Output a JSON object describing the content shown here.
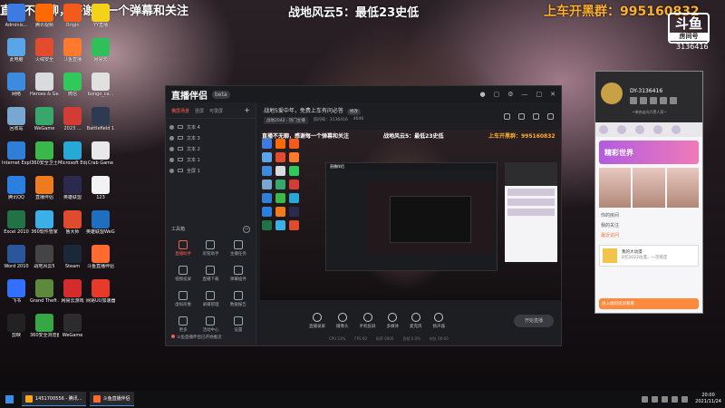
{
  "overlay": {
    "left_text": "直播不无聊，感谢每一个弹幕和关注",
    "center_text": "战地风云5：最低23史低",
    "right_text": "上车开黑群：995160832",
    "logo_text": "斗鱼",
    "logo_sub": "房间号",
    "room_id": "3136416"
  },
  "desktop_icons": [
    {
      "label": "Adminis...",
      "color": "#3d7be0"
    },
    {
      "label": "腾讯视频",
      "color": "#ff6a00"
    },
    {
      "label": "Origin",
      "color": "#f25b1b"
    },
    {
      "label": "YY直播",
      "color": "#f5d21a"
    },
    {
      "label": "此电脑",
      "color": "#5aa5e8"
    },
    {
      "label": "火绒安全",
      "color": "#e34b2e"
    },
    {
      "label": "斗鱼直播",
      "color": "#ff7a2f"
    },
    {
      "label": "网易云",
      "color": "#2fc05a"
    },
    {
      "label": "网络",
      "color": "#3d8bdf"
    },
    {
      "label": "Heroes & Generals",
      "color": "#d8dcdf"
    },
    {
      "label": "微信",
      "color": "#31c95c"
    },
    {
      "label": "bongo_ca...",
      "color": "#e0e0e0"
    },
    {
      "label": "回收站",
      "color": "#7aa7d0"
    },
    {
      "label": "WeGame",
      "color": "#36a86b"
    },
    {
      "label": "2023 ...",
      "color": "#d33b35"
    },
    {
      "label": "Battlefield 1",
      "color": "#2d3b52"
    },
    {
      "label": "Internet Explorer",
      "color": "#2f7ed8"
    },
    {
      "label": "360安全卫士",
      "color": "#3bb84a"
    },
    {
      "label": "Microsoft Edge",
      "color": "#28a8d6"
    },
    {
      "label": "Crab Game",
      "color": "#e8e8e8"
    },
    {
      "label": "腾讯QQ",
      "color": "#2a7fe0"
    },
    {
      "label": "直播伴侣",
      "color": "#f07a1e"
    },
    {
      "label": "英雄联盟",
      "color": "#2a2a4e"
    },
    {
      "label": "123",
      "color": "#f2f2f2"
    },
    {
      "label": "Excel 2010",
      "color": "#217346"
    },
    {
      "label": "360软件管家",
      "color": "#3bb0e8"
    },
    {
      "label": "鲁大师",
      "color": "#e04a2e"
    },
    {
      "label": "英雄联盟WeGame版",
      "color": "#1e6fc0"
    },
    {
      "label": "Word 2010",
      "color": "#2b579a"
    },
    {
      "label": "战地风云5",
      "color": "#444"
    },
    {
      "label": "Steam",
      "color": "#1b2838"
    },
    {
      "label": "斗鱼直播伴侣",
      "color": "#ff6a30"
    },
    {
      "label": "飞书",
      "color": "#3370ff"
    },
    {
      "label": "Grand Theft Auto V",
      "color": "#5c8a3a"
    },
    {
      "label": "网易云游戏",
      "color": "#d42c2c"
    },
    {
      "label": "网易UU加速器",
      "color": "#e83a2a"
    },
    {
      "label": "剪映",
      "color": "#222"
    },
    {
      "label": "360安全浏览器",
      "color": "#35a845"
    },
    {
      "label": "WeGame",
      "color": "#2c2c2c"
    }
  ],
  "app": {
    "logo": "直播伴侣",
    "version": "beta",
    "window_controls": [
      "最小化",
      "最大化",
      "关闭"
    ],
    "left_tabs": [
      "横屏场景",
      "竖屏",
      "可录屏"
    ],
    "sources": [
      {
        "label": "文本 4"
      },
      {
        "label": "文本 3"
      },
      {
        "label": "文本 2"
      },
      {
        "label": "文本 1"
      },
      {
        "label": "全屏 1"
      }
    ],
    "tools_heading": "工具箱",
    "tools": [
      {
        "label": "直播助手",
        "red": true
      },
      {
        "label": "房管助手",
        "red": false
      },
      {
        "label": "主播任务",
        "red": false
      },
      {
        "label": "视频投屏",
        "red": false
      },
      {
        "label": "直播下载",
        "red": false
      },
      {
        "label": "弹幕插件",
        "red": false
      },
      {
        "label": "虚拟形象",
        "red": false
      },
      {
        "label": "录播管理",
        "red": false
      },
      {
        "label": "数据报告",
        "red": false
      },
      {
        "label": "更多",
        "red": false
      },
      {
        "label": "活动中心",
        "red": false
      },
      {
        "label": "设置",
        "red": false
      }
    ],
    "left_footer": "斗鱼直播伴侣已开始推流",
    "stream_title": "战地5爱中年，免费上车有问必答",
    "edit_label": "修改",
    "meta": [
      "战地2042 · 热门主播",
      "房间号：3136416",
      "4646"
    ],
    "preview_text_left": "直播不无聊，感谢每一个弹幕和关注",
    "preview_text_center": "战地风云5：最低23史低",
    "preview_text_right": "上车开黑群：995160832",
    "preview_icon_colors": [
      "#3d7be0",
      "#ff6a00",
      "#f25b1b",
      "#5aa5e8",
      "#e34b2e",
      "#ff7a2f",
      "#3d8bdf",
      "#d8dcdf",
      "#31c95c",
      "#7aa7d0",
      "#36a86b",
      "#d33b35",
      "#2f7ed8",
      "#3bb84a",
      "#28a8d6",
      "#2a7fe0",
      "#f07a1e",
      "#2a2a4e",
      "#217346",
      "#3bb0e8",
      "#e04a2e"
    ],
    "controls": [
      "直播录屏",
      "摄像头",
      "手机投屏",
      "多媒体",
      "麦克风",
      "扬声器"
    ],
    "live_button": "开始直播",
    "status": [
      "CPU 23%",
      "FPS 60",
      "码率 6000",
      "丢帧 0.0%",
      "时长 00:00"
    ]
  },
  "user_panel": {
    "name": "DY-3136416",
    "signature": "~带你走向开黑人家~",
    "banner": "精彩世界",
    "links": [
      "你的房间",
      "我的关注",
      "最近访问"
    ],
    "card_title": "我的大动漫",
    "card_sub": "8元2022动漫，一次搞定",
    "footer": "进入她的房间看看"
  },
  "taskbar": {
    "tasks": [
      {
        "label": "1451700556 - 腾讯...",
        "color": "#f5a623"
      },
      {
        "label": "斗鱼直播伴侣",
        "color": "#ff6a30"
      }
    ],
    "time": "20:00",
    "date": "2021/11/24"
  }
}
